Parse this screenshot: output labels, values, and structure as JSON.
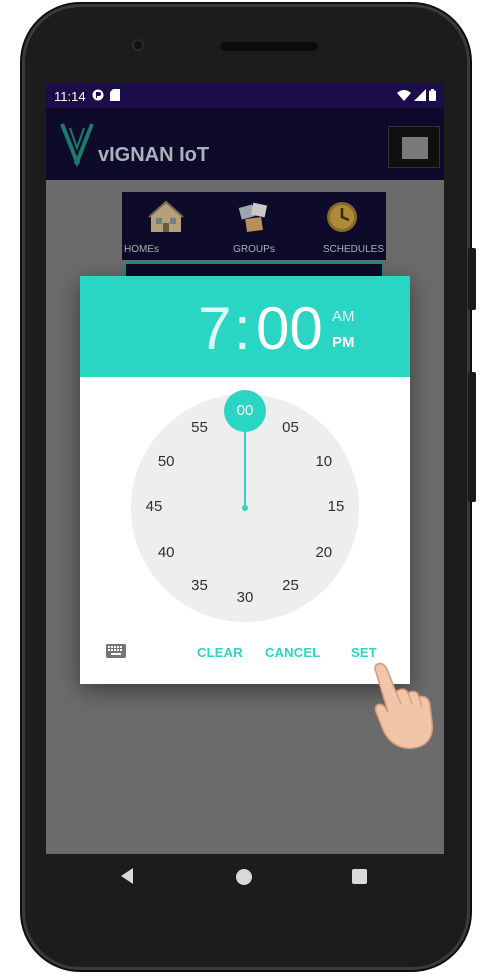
{
  "status_bar": {
    "time": "11:14"
  },
  "app_bar": {
    "title": "vIGNAN IoT"
  },
  "tabs": [
    {
      "label": "HOMEs"
    },
    {
      "label": "GROUPs"
    },
    {
      "label": "SCHEDULES"
    }
  ],
  "time_picker": {
    "hour": "7",
    "separator": ":",
    "minute": "00",
    "am_label": "AM",
    "pm_label": "PM",
    "selected_period": "PM",
    "clock_numbers": [
      "00",
      "05",
      "10",
      "15",
      "20",
      "25",
      "30",
      "35",
      "40",
      "45",
      "50",
      "55"
    ],
    "selected_minute": "00",
    "buttons": {
      "clear": "CLEAR",
      "cancel": "CANCEL",
      "set": "SET"
    }
  },
  "colors": {
    "accent": "#2ad5c3",
    "status_bar": "#1b0d4a",
    "app_bar": "#0d0a2a",
    "scrim": "#6b6b6b",
    "clock_face": "#eeeeee"
  },
  "icons": [
    "alarm-clock-icon",
    "puzzle-pieces-icon",
    "house-icon",
    "keyboard-icon",
    "wifi-icon",
    "signal-icon",
    "battery-icon",
    "menu-icon",
    "back-icon",
    "home-nav-icon",
    "recents-icon"
  ]
}
